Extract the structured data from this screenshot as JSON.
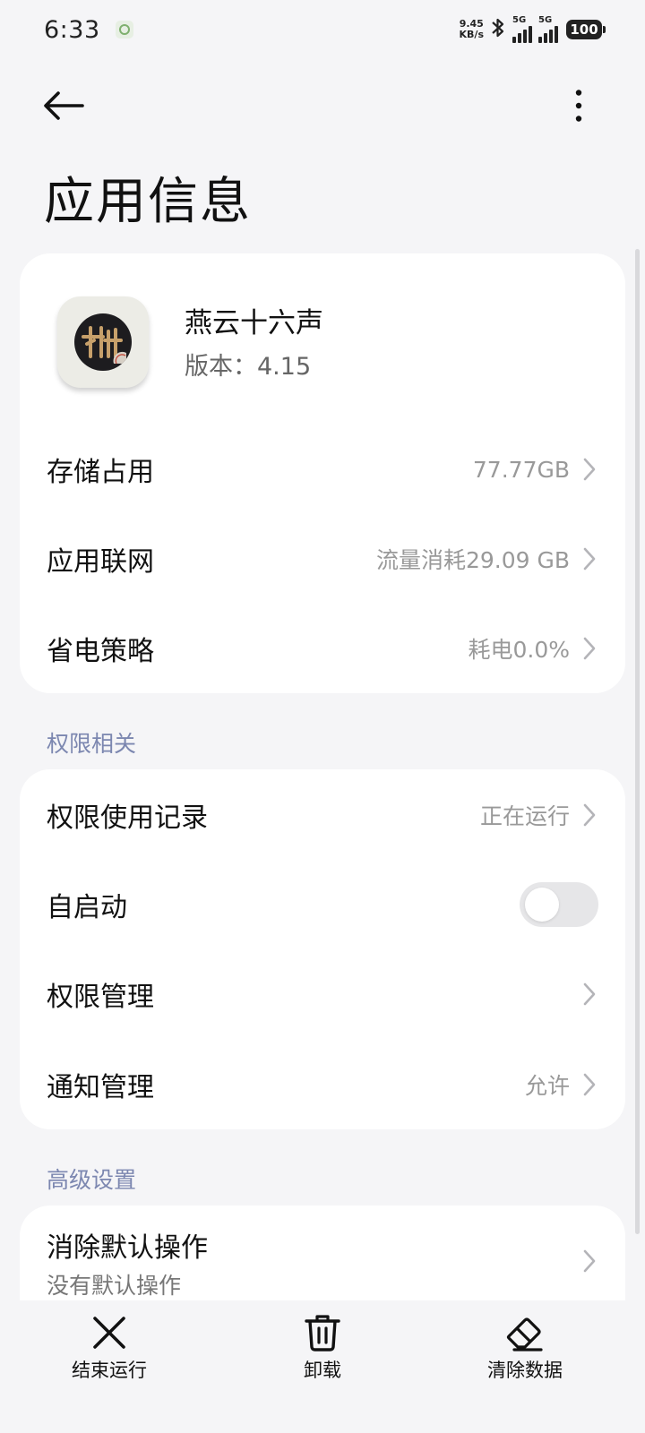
{
  "status_bar": {
    "time": "6:33",
    "net_speed_value": "9.45",
    "net_speed_unit": "KB/s",
    "sim1_type": "5G",
    "sim2_type": "5G",
    "battery": "100"
  },
  "header": {
    "title": "应用信息"
  },
  "app": {
    "name": "燕云十六声",
    "version": "版本：4.15"
  },
  "main_rows": [
    {
      "label": "存储占用",
      "value": "77.77GB"
    },
    {
      "label": "应用联网",
      "value": "流量消耗29.09 GB"
    },
    {
      "label": "省电策略",
      "value": "耗电0.0%"
    }
  ],
  "permissions_section": {
    "title": "权限相关",
    "rows": [
      {
        "label": "权限使用记录",
        "value": "正在运行"
      },
      {
        "label": "自启动",
        "toggle_on": false
      },
      {
        "label": "权限管理",
        "value": ""
      },
      {
        "label": "通知管理",
        "value": "允许"
      }
    ]
  },
  "advanced_section": {
    "title": "高级设置",
    "rows": [
      {
        "label": "消除默认操作",
        "sublabel": "没有默认操作"
      }
    ]
  },
  "bottom_actions": [
    {
      "label": "结束运行",
      "icon": "close-icon"
    },
    {
      "label": "卸载",
      "icon": "trash-icon"
    },
    {
      "label": "清除数据",
      "icon": "eraser-icon"
    }
  ],
  "colors": {
    "background": "#f5f5f7",
    "card": "#ffffff",
    "section_title": "#7c87b0",
    "secondary_text": "#999999"
  }
}
